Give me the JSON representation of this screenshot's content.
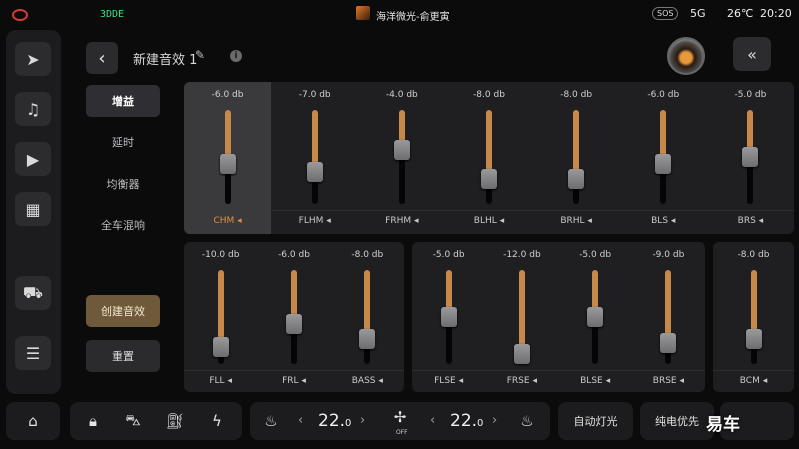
{
  "status_bar": {
    "left_indicator": "3DDE",
    "now_playing": "海洋微光-俞更寅",
    "sos": "SOS",
    "network": "5G",
    "temperature": "26℃",
    "time": "20:20"
  },
  "left_nav": {
    "items": [
      "navigation-icon",
      "music-icon",
      "media-icon",
      "apps-grid-icon",
      "car-icon",
      "settings-toggle-icon"
    ]
  },
  "header": {
    "title": "新建音效 1"
  },
  "side_menu": {
    "items": [
      "增益",
      "延时",
      "均衡器",
      "全车混响"
    ],
    "active": "增益",
    "create_label": "创建音效",
    "reset_label": "重置"
  },
  "channels_top": [
    {
      "name": "CHM",
      "db": "-6.0 db",
      "level": 0.4,
      "selected": true
    },
    {
      "name": "FLHM",
      "db": "-7.0 db",
      "level": 0.3,
      "selected": false
    },
    {
      "name": "FRHM",
      "db": "-4.0 db",
      "level": 0.6,
      "selected": false
    },
    {
      "name": "BLHL",
      "db": "-8.0 db",
      "level": 0.2,
      "selected": false
    },
    {
      "name": "BRHL",
      "db": "-8.0 db",
      "level": 0.2,
      "selected": false
    },
    {
      "name": "BLS",
      "db": "-6.0 db",
      "level": 0.4,
      "selected": false
    },
    {
      "name": "BRS",
      "db": "-5.0 db",
      "level": 0.5,
      "selected": false
    }
  ],
  "channels_bottom_a": [
    {
      "name": "FLL",
      "db": "-10.0 db",
      "level": 0.1
    },
    {
      "name": "FRL",
      "db": "-6.0 db",
      "level": 0.4
    },
    {
      "name": "BASS",
      "db": "-8.0 db",
      "level": 0.2
    }
  ],
  "channels_bottom_b": [
    {
      "name": "FLSE",
      "db": "-5.0 db",
      "level": 0.5
    },
    {
      "name": "FRSE",
      "db": "-12.0 db",
      "level": 0.0
    },
    {
      "name": "BLSE",
      "db": "-5.0 db",
      "level": 0.5
    },
    {
      "name": "BRSE",
      "db": "-9.0 db",
      "level": 0.15
    }
  ],
  "channels_bottom_c": [
    {
      "name": "BCM",
      "db": "-8.0 db",
      "level": 0.2
    }
  ],
  "bottom_bar": {
    "left_temp": "22.",
    "left_temp_decimal": "0",
    "right_temp": "22.",
    "right_temp_decimal": "0",
    "fan_state": "OFF",
    "auto_light": "自动灯光",
    "ev_priority": "纯电优先"
  },
  "watermark": "易车"
}
